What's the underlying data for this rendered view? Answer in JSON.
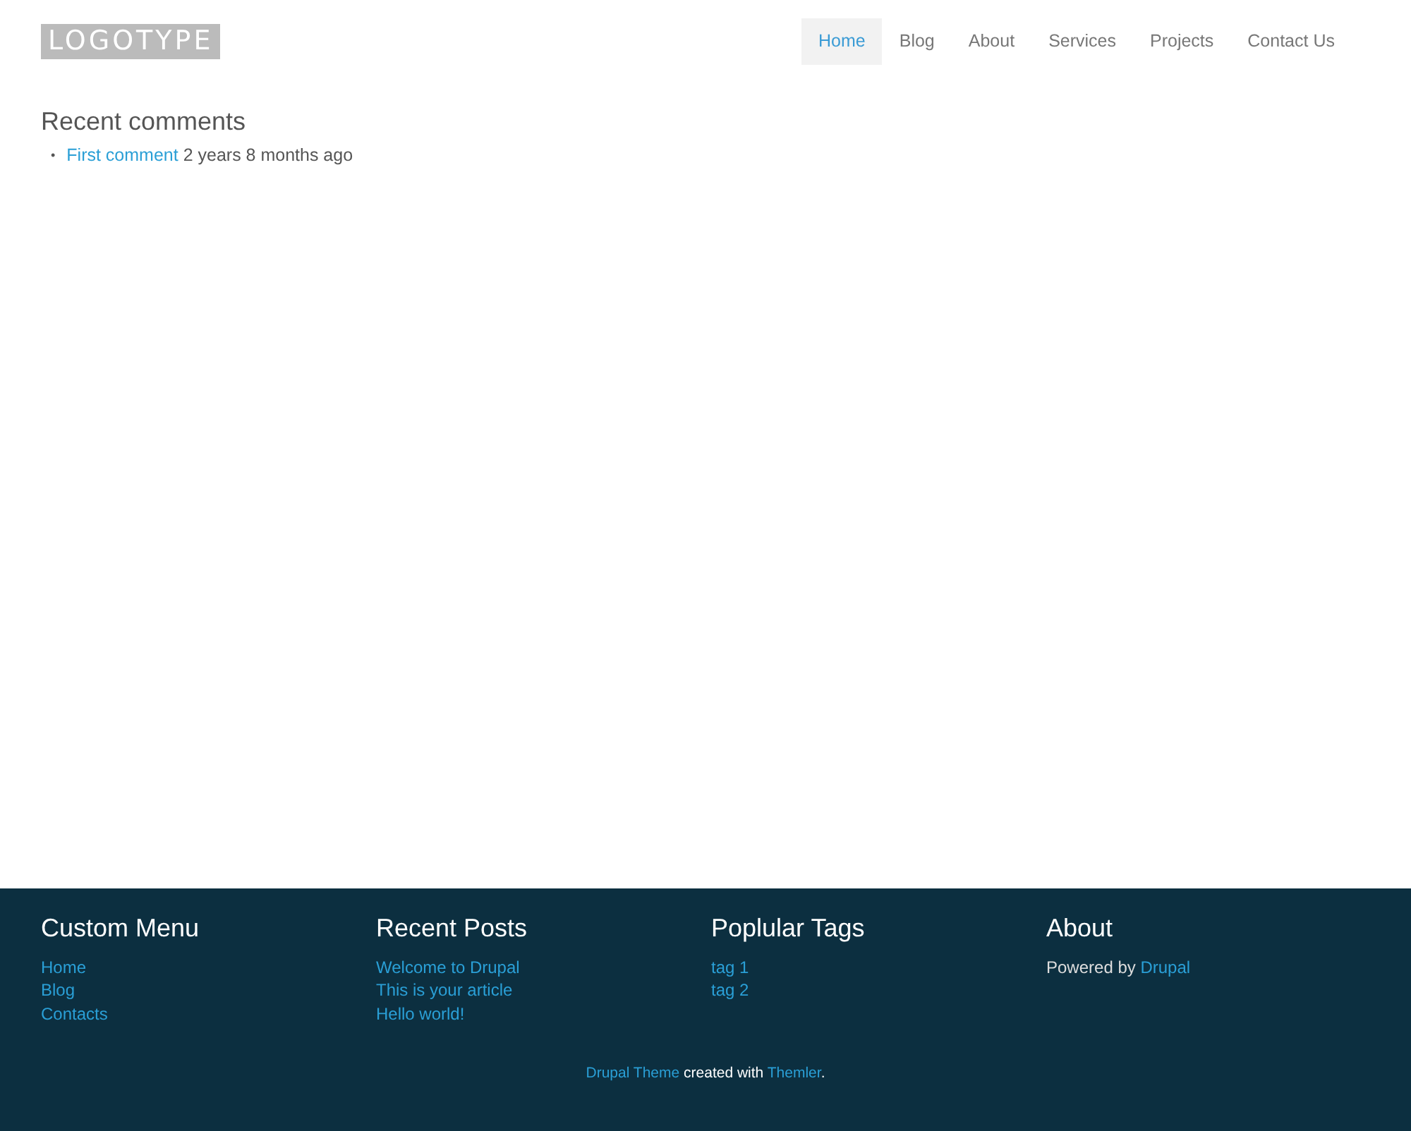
{
  "logo": "LOGOTYPE",
  "nav": [
    {
      "label": "Home",
      "selected": true
    },
    {
      "label": "Blog",
      "selected": false
    },
    {
      "label": "About",
      "selected": false
    },
    {
      "label": "Services",
      "selected": false
    },
    {
      "label": "Projects",
      "selected": false
    },
    {
      "label": "Contact Us",
      "selected": false
    }
  ],
  "recent_comments": {
    "title": "Recent comments",
    "items": [
      {
        "marker": "•",
        "link": "First comment",
        "time": "2 years 8 months ago"
      }
    ]
  },
  "footer": {
    "columns": [
      {
        "kind": "links",
        "title": "Custom Menu",
        "links": [
          "Home",
          "Blog",
          "Contacts"
        ]
      },
      {
        "kind": "links",
        "title": "Recent Posts",
        "links": [
          "Welcome to Drupal",
          "This is your article",
          "Hello world!"
        ]
      },
      {
        "kind": "links",
        "title": "Poplular Tags",
        "links": [
          "tag 1",
          "tag 2"
        ]
      },
      {
        "kind": "text",
        "title": "About",
        "text": "Powered by",
        "link": "Drupal"
      }
    ],
    "credit": {
      "link_1": "Drupal Theme",
      "text": "created with",
      "link_2": "Themler",
      "end": "."
    }
  }
}
